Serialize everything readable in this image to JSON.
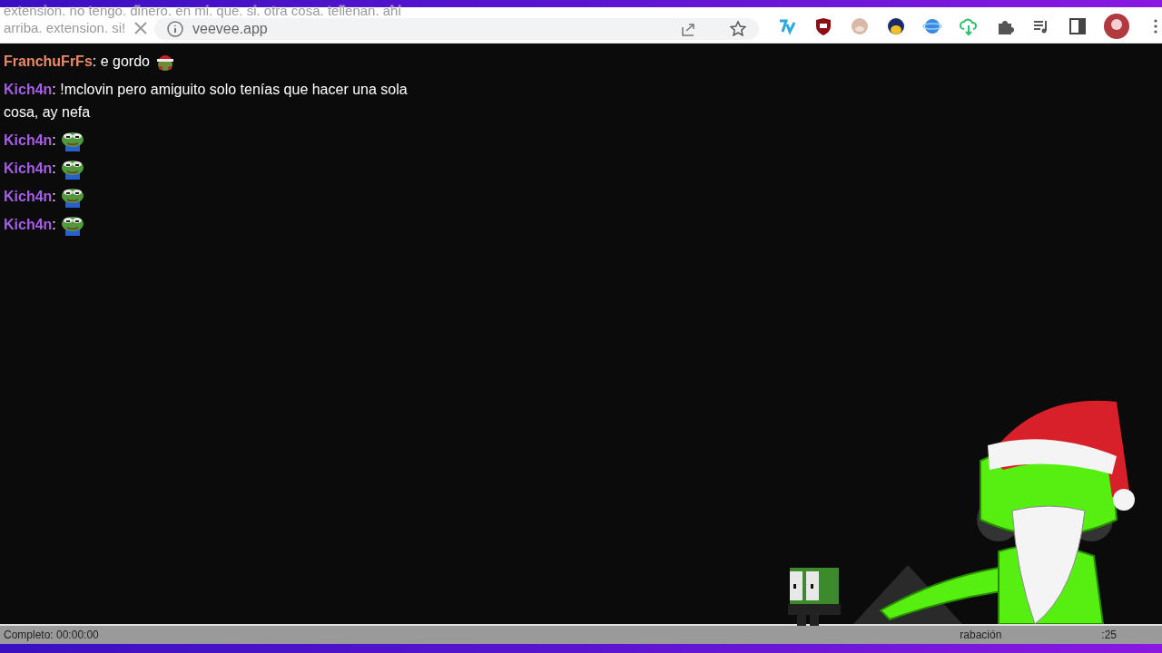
{
  "caption": [
    "extension. no tengo. dinero. en mi. que. si. otra cosa. tellenan. ahi",
    "arriba. extension. si!"
  ],
  "browser": {
    "address": "veevee.app"
  },
  "chat": [
    {
      "user": "FranchuFrFs",
      "color": "#e88a6a",
      "text": ": e gordo",
      "kind": "santa"
    },
    {
      "user": "Kich4n",
      "color": "#a45ee5",
      "text": ": !mclovin pero amiguito solo tenías que hacer una sola cosa, ay nefa",
      "kind": "plain"
    },
    {
      "user": "Kich4n",
      "color": "#a45ee5",
      "text": ":",
      "kind": "frog"
    },
    {
      "user": "Kich4n",
      "color": "#a45ee5",
      "text": ":",
      "kind": "frog"
    },
    {
      "user": "Kich4n",
      "color": "#a45ee5",
      "text": ":",
      "kind": "frog"
    },
    {
      "user": "Kich4n",
      "color": "#a45ee5",
      "text": ":",
      "kind": "frog"
    }
  ],
  "status_bar": {
    "left": "Completo: 00:00:00",
    "middle": "rabación",
    "right": ":25"
  }
}
